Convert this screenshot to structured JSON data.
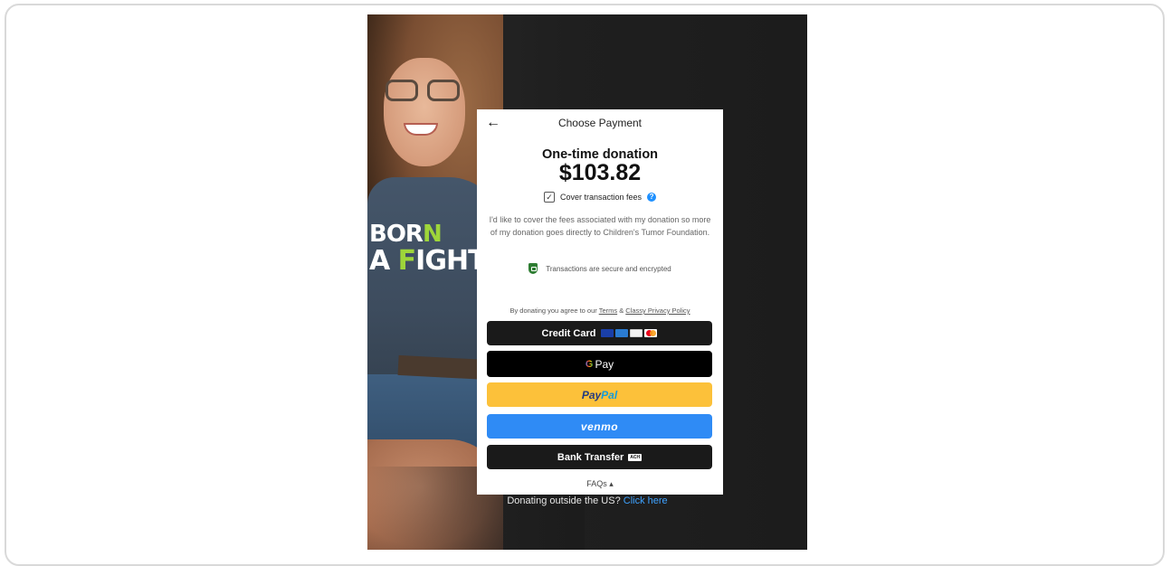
{
  "payment": {
    "title": "Choose Payment",
    "back_icon": "←",
    "donation_type": "One-time donation",
    "amount": "$103.82",
    "cover_fees_label": "Cover transaction fees",
    "cover_fees_checked": true,
    "help_icon": "?",
    "description": "I'd like to cover the fees associated with my donation so more of my donation goes directly to Children's Tumor Foundation.",
    "secure_text": "Transactions are secure and encrypted",
    "agree": {
      "prefix": "By donating you agree to our ",
      "terms": "Terms",
      "amp": " & ",
      "privacy": "Classy Privacy Policy"
    },
    "buttons": {
      "credit_card": "Credit Card",
      "gpay_g": "G",
      "gpay": "Pay",
      "paypal_pay": "Pay",
      "paypal_pal": "Pal",
      "venmo": "venmo",
      "bank_transfer": "Bank Transfer",
      "ach_badge": "ACH"
    },
    "faqs": "FAQs ▴"
  },
  "background": {
    "shirt_line1_a": "BOR",
    "shirt_line1_b": "N",
    "shirt_line2_a": "A ",
    "shirt_line2_b": "F",
    "shirt_line2_c": "IGHTER.",
    "outside_us_text": "Donating outside the US? ",
    "outside_us_link": "Click here"
  },
  "colors": {
    "paypal": "#fcc13a",
    "venmo": "#2f8bf5",
    "dark_button": "#1a1a1a",
    "link_blue": "#3ea2ff"
  }
}
